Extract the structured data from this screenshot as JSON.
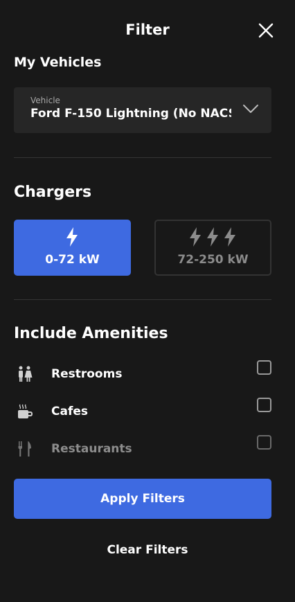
{
  "header": {
    "title": "Filter",
    "close_icon": "close-icon"
  },
  "vehicles": {
    "section_title": "My Vehicles",
    "select_label": "Vehicle",
    "select_value": "Ford F-150 Lightning (No NACS",
    "chevron_icon": "chevron-down-icon"
  },
  "chargers": {
    "section_title": "Chargers",
    "options": [
      {
        "label": "0-72 kW",
        "icon": "single-bolt-icon",
        "selected": true
      },
      {
        "label": "72-250 kW",
        "icon": "triple-bolt-icon",
        "selected": false
      }
    ]
  },
  "amenities": {
    "section_title": "Include Amenities",
    "items": [
      {
        "label": "Restrooms",
        "icon": "restroom-icon",
        "checked": false
      },
      {
        "label": "Cafes",
        "icon": "coffee-cup-icon",
        "checked": false
      },
      {
        "label": "Restaurants",
        "icon": "fork-knife-icon",
        "checked": false
      }
    ]
  },
  "actions": {
    "apply_label": "Apply Filters",
    "clear_label": "Clear Filters"
  },
  "colors": {
    "background": "#181818",
    "accent": "#3e6ae1",
    "panel": "#262626"
  }
}
